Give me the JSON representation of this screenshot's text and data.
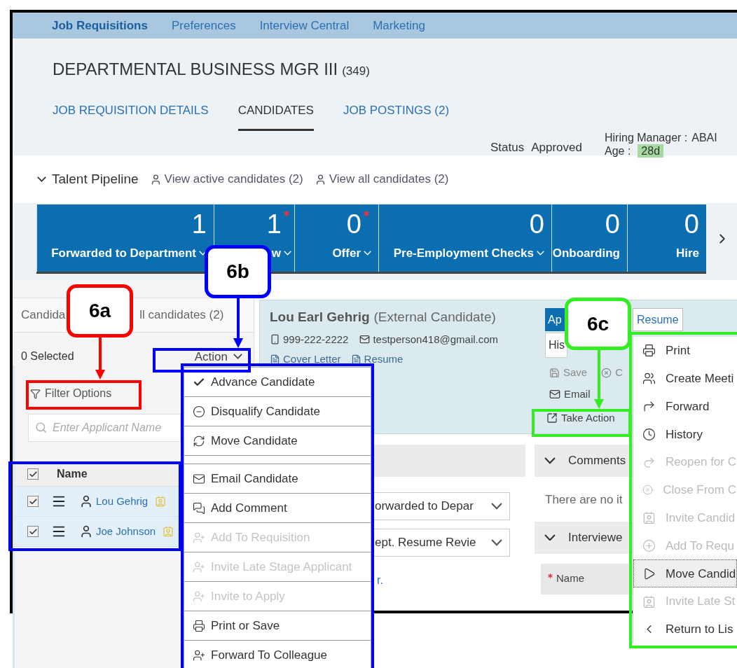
{
  "nav": [
    {
      "label": "Job Requisitions",
      "selected": true
    },
    {
      "label": "Preferences",
      "selected": false
    },
    {
      "label": "Interview Central",
      "selected": false
    },
    {
      "label": "Marketing",
      "selected": false
    }
  ],
  "requisition": {
    "title": "DEPARTMENTAL BUSINESS MGR III",
    "count": "(349)"
  },
  "tabs": [
    {
      "label": "JOB REQUISITION DETAILS",
      "selected": false
    },
    {
      "label": "CANDIDATES",
      "selected": true
    },
    {
      "label": "JOB POSTINGS (2)",
      "selected": false
    }
  ],
  "status": {
    "label": "Status",
    "value": "Approved"
  },
  "hiring_manager": {
    "label": "Hiring Manager :",
    "value": "ABAI"
  },
  "age": {
    "label": "Age :",
    "value": "28d"
  },
  "pipeline": {
    "title": "Talent Pipeline",
    "expanded": true,
    "links": [
      "View active candidates (2)",
      "View all candidates (2)"
    ],
    "stages": [
      {
        "count": "1",
        "label": "Forwarded to Department",
        "required": false,
        "has_menu": true
      },
      {
        "count": "1",
        "label": "w",
        "required": true,
        "has_menu": true
      },
      {
        "count": "0",
        "label": "Offer",
        "required": true,
        "has_menu": true
      },
      {
        "count": "0",
        "label": "Pre-Employment Checks",
        "required": false,
        "has_menu": true
      },
      {
        "count": "0",
        "label": "Onboarding",
        "required": false,
        "has_menu": false
      },
      {
        "count": "0",
        "label": "Hire",
        "required": false,
        "has_menu": false
      }
    ]
  },
  "candidates_panel": {
    "tabs": [
      "Candida",
      "ll candidates (2)"
    ],
    "selected_count": "0 Selected",
    "action_button": "Action",
    "filter": "Filter Options",
    "search": {
      "placeholder": "Enter Applicant Name"
    },
    "all_checked": true,
    "column": "Name",
    "rows": [
      {
        "name": "Lou Gehrig",
        "checked": true
      },
      {
        "name": "Joe Johnson",
        "checked": true
      }
    ]
  },
  "candidate": {
    "name": "Lou Earl Gehrig",
    "type": "(External Candidate)",
    "phone": "999-222-2222",
    "email": "testperson418@gmail.com",
    "documents": [
      "Cover Letter",
      "Resume"
    ],
    "tabs": [
      {
        "label": "Ap",
        "selected": true
      },
      {
        "label": "Resume",
        "selected": false
      }
    ],
    "view_field": "His",
    "actions": [
      {
        "label": "Save",
        "disabled": true
      },
      {
        "label": "C",
        "disabled": true
      },
      {
        "label": "Email",
        "disabled": false
      },
      {
        "label": "Take Action",
        "disabled": false
      }
    ]
  },
  "status_fields": [
    "orwarded to Depar",
    "ept. Resume Revie"
  ],
  "note_link": "r.",
  "comments": {
    "title": "Comments",
    "expanded": true,
    "empty_text": "There are no it"
  },
  "interviewers": {
    "title": "Interviewe",
    "expanded": true,
    "column": "Name",
    "required": true
  },
  "action_menu": [
    {
      "label": "Advance Candidate",
      "disabled": false
    },
    {
      "label": "Disqualify Candidate",
      "disabled": false
    },
    {
      "label": "Move Candidate",
      "disabled": false
    },
    {
      "label": "Email Candidate",
      "disabled": false
    },
    {
      "label": "Add Comment",
      "disabled": false
    },
    {
      "label": "Add To Requisition",
      "disabled": true
    },
    {
      "label": "Invite Late Stage Applicant",
      "disabled": true
    },
    {
      "label": "Invite to Apply",
      "disabled": true
    },
    {
      "label": "Print or Save",
      "disabled": false
    },
    {
      "label": "Forward To Colleague",
      "disabled": false
    }
  ],
  "take_action_menu": [
    {
      "label": "Print",
      "disabled": false,
      "selected": false
    },
    {
      "label": "Create Meeti",
      "disabled": false,
      "selected": false
    },
    {
      "label": "Forward",
      "disabled": false,
      "selected": false
    },
    {
      "label": "History",
      "disabled": false,
      "selected": false
    },
    {
      "label": "Reopen for C",
      "disabled": true,
      "selected": false
    },
    {
      "label": "Close From C",
      "disabled": true,
      "selected": false
    },
    {
      "label": "Invite Candid",
      "disabled": true,
      "selected": false
    },
    {
      "label": "Add To Requ",
      "disabled": true,
      "selected": false
    },
    {
      "label": "Move Candid",
      "disabled": false,
      "selected": true
    },
    {
      "label": "Invite Late St",
      "disabled": true,
      "selected": false
    },
    {
      "label": "Return to Lis",
      "disabled": false,
      "selected": false
    }
  ],
  "callouts": [
    {
      "label": "6a",
      "color": "#ff0000"
    },
    {
      "label": "6b",
      "color": "#0000ff"
    },
    {
      "label": "6c",
      "color": "#33ee22"
    }
  ]
}
